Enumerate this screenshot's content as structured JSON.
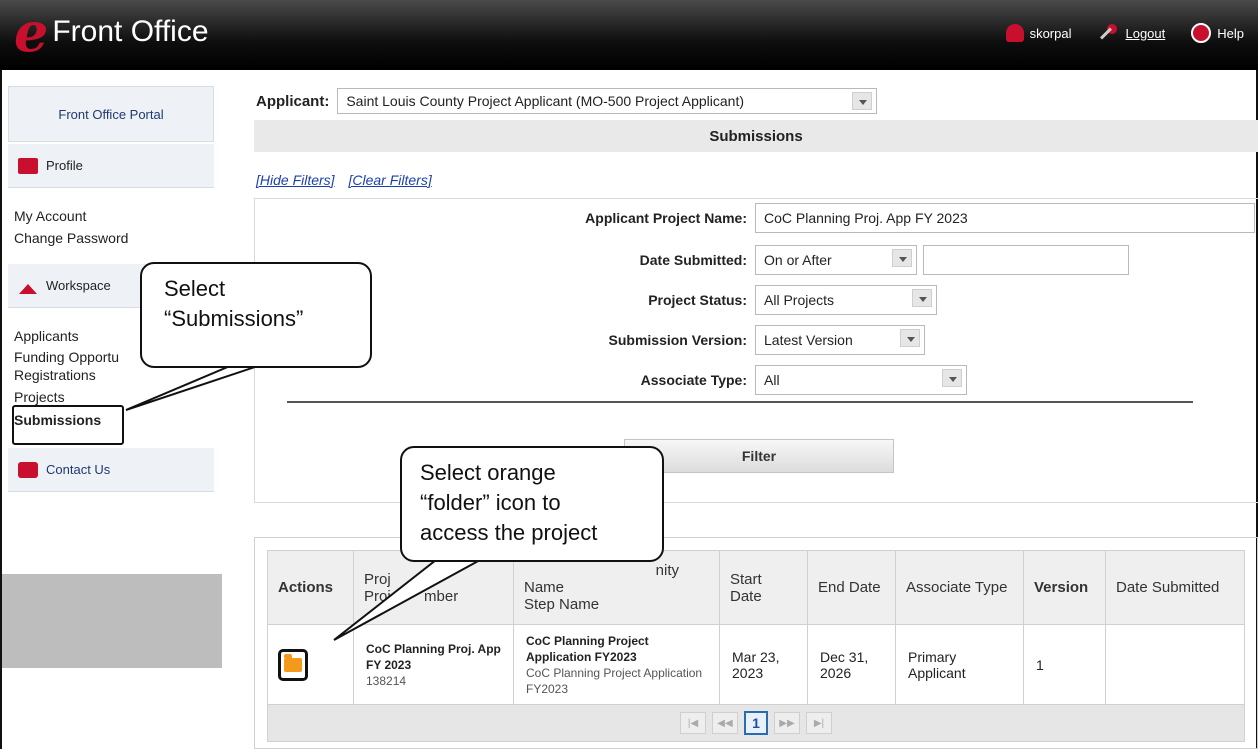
{
  "header": {
    "brand_letter": "e",
    "brand_title": "Front Office",
    "user": "skorpal",
    "logout": "Logout",
    "help": "Help"
  },
  "sidebar": {
    "portal": "Front Office Portal",
    "profile_head": "Profile",
    "profile_links": [
      "My Account",
      "Change Password"
    ],
    "workspace_head": "Workspace",
    "workspace_links": [
      "Applicants",
      "Funding Opportu",
      "Registrations",
      "Projects",
      "Submissions"
    ],
    "contact_head": "Contact Us"
  },
  "applicant": {
    "label": "Applicant:",
    "value": "Saint Louis County Project Applicant (MO-500 Project Applicant)"
  },
  "section_title": "Submissions",
  "filter_links": {
    "hide": "[Hide Filters]",
    "clear": "[Clear Filters]"
  },
  "filters": {
    "project_name_label": "Applicant Project Name:",
    "project_name_value": "CoC Planning Proj. App FY 2023",
    "date_label": "Date Submitted:",
    "date_op": "On or After",
    "date_value": "",
    "status_label": "Project Status:",
    "status_value": "All Projects",
    "version_label": "Submission Version:",
    "version_value": "Latest Version",
    "assoc_label": "Associate Type:",
    "assoc_value": "All",
    "filter_button": "Filter"
  },
  "table": {
    "headers": {
      "actions": "Actions",
      "project_line1": "Proj",
      "project_line2": "Proje",
      "project_line2b": "mber",
      "funding_line1": "nity",
      "funding_line2": "Name",
      "funding_line3": "Step Name",
      "start": "Start Date",
      "end": "End Date",
      "assoc": "Associate Type",
      "version": "Version",
      "submitted": "Date Submitted"
    },
    "row": {
      "project_name": "CoC Planning Proj. App FY 2023",
      "project_number": "138214",
      "funding_name": "CoC Planning Project Application FY2023",
      "step_name": "CoC Planning Project Application FY2023",
      "start": "Mar 23, 2023",
      "end": "Dec 31, 2026",
      "assoc": "Primary Applicant",
      "version": "1",
      "submitted": ""
    },
    "pager": {
      "first": "|◀",
      "prev": "◀◀",
      "page": "1",
      "next": "▶▶",
      "last": "▶|"
    }
  },
  "callouts": {
    "submissions": "Select “Submissions”",
    "folder_line1": "Select orange",
    "folder_line2": "“folder” icon to",
    "folder_line3": "access the project"
  },
  "colors": {
    "brand_red": "#c8102e",
    "folder_orange": "#f39a1d",
    "link_blue": "#1a3fb0"
  }
}
